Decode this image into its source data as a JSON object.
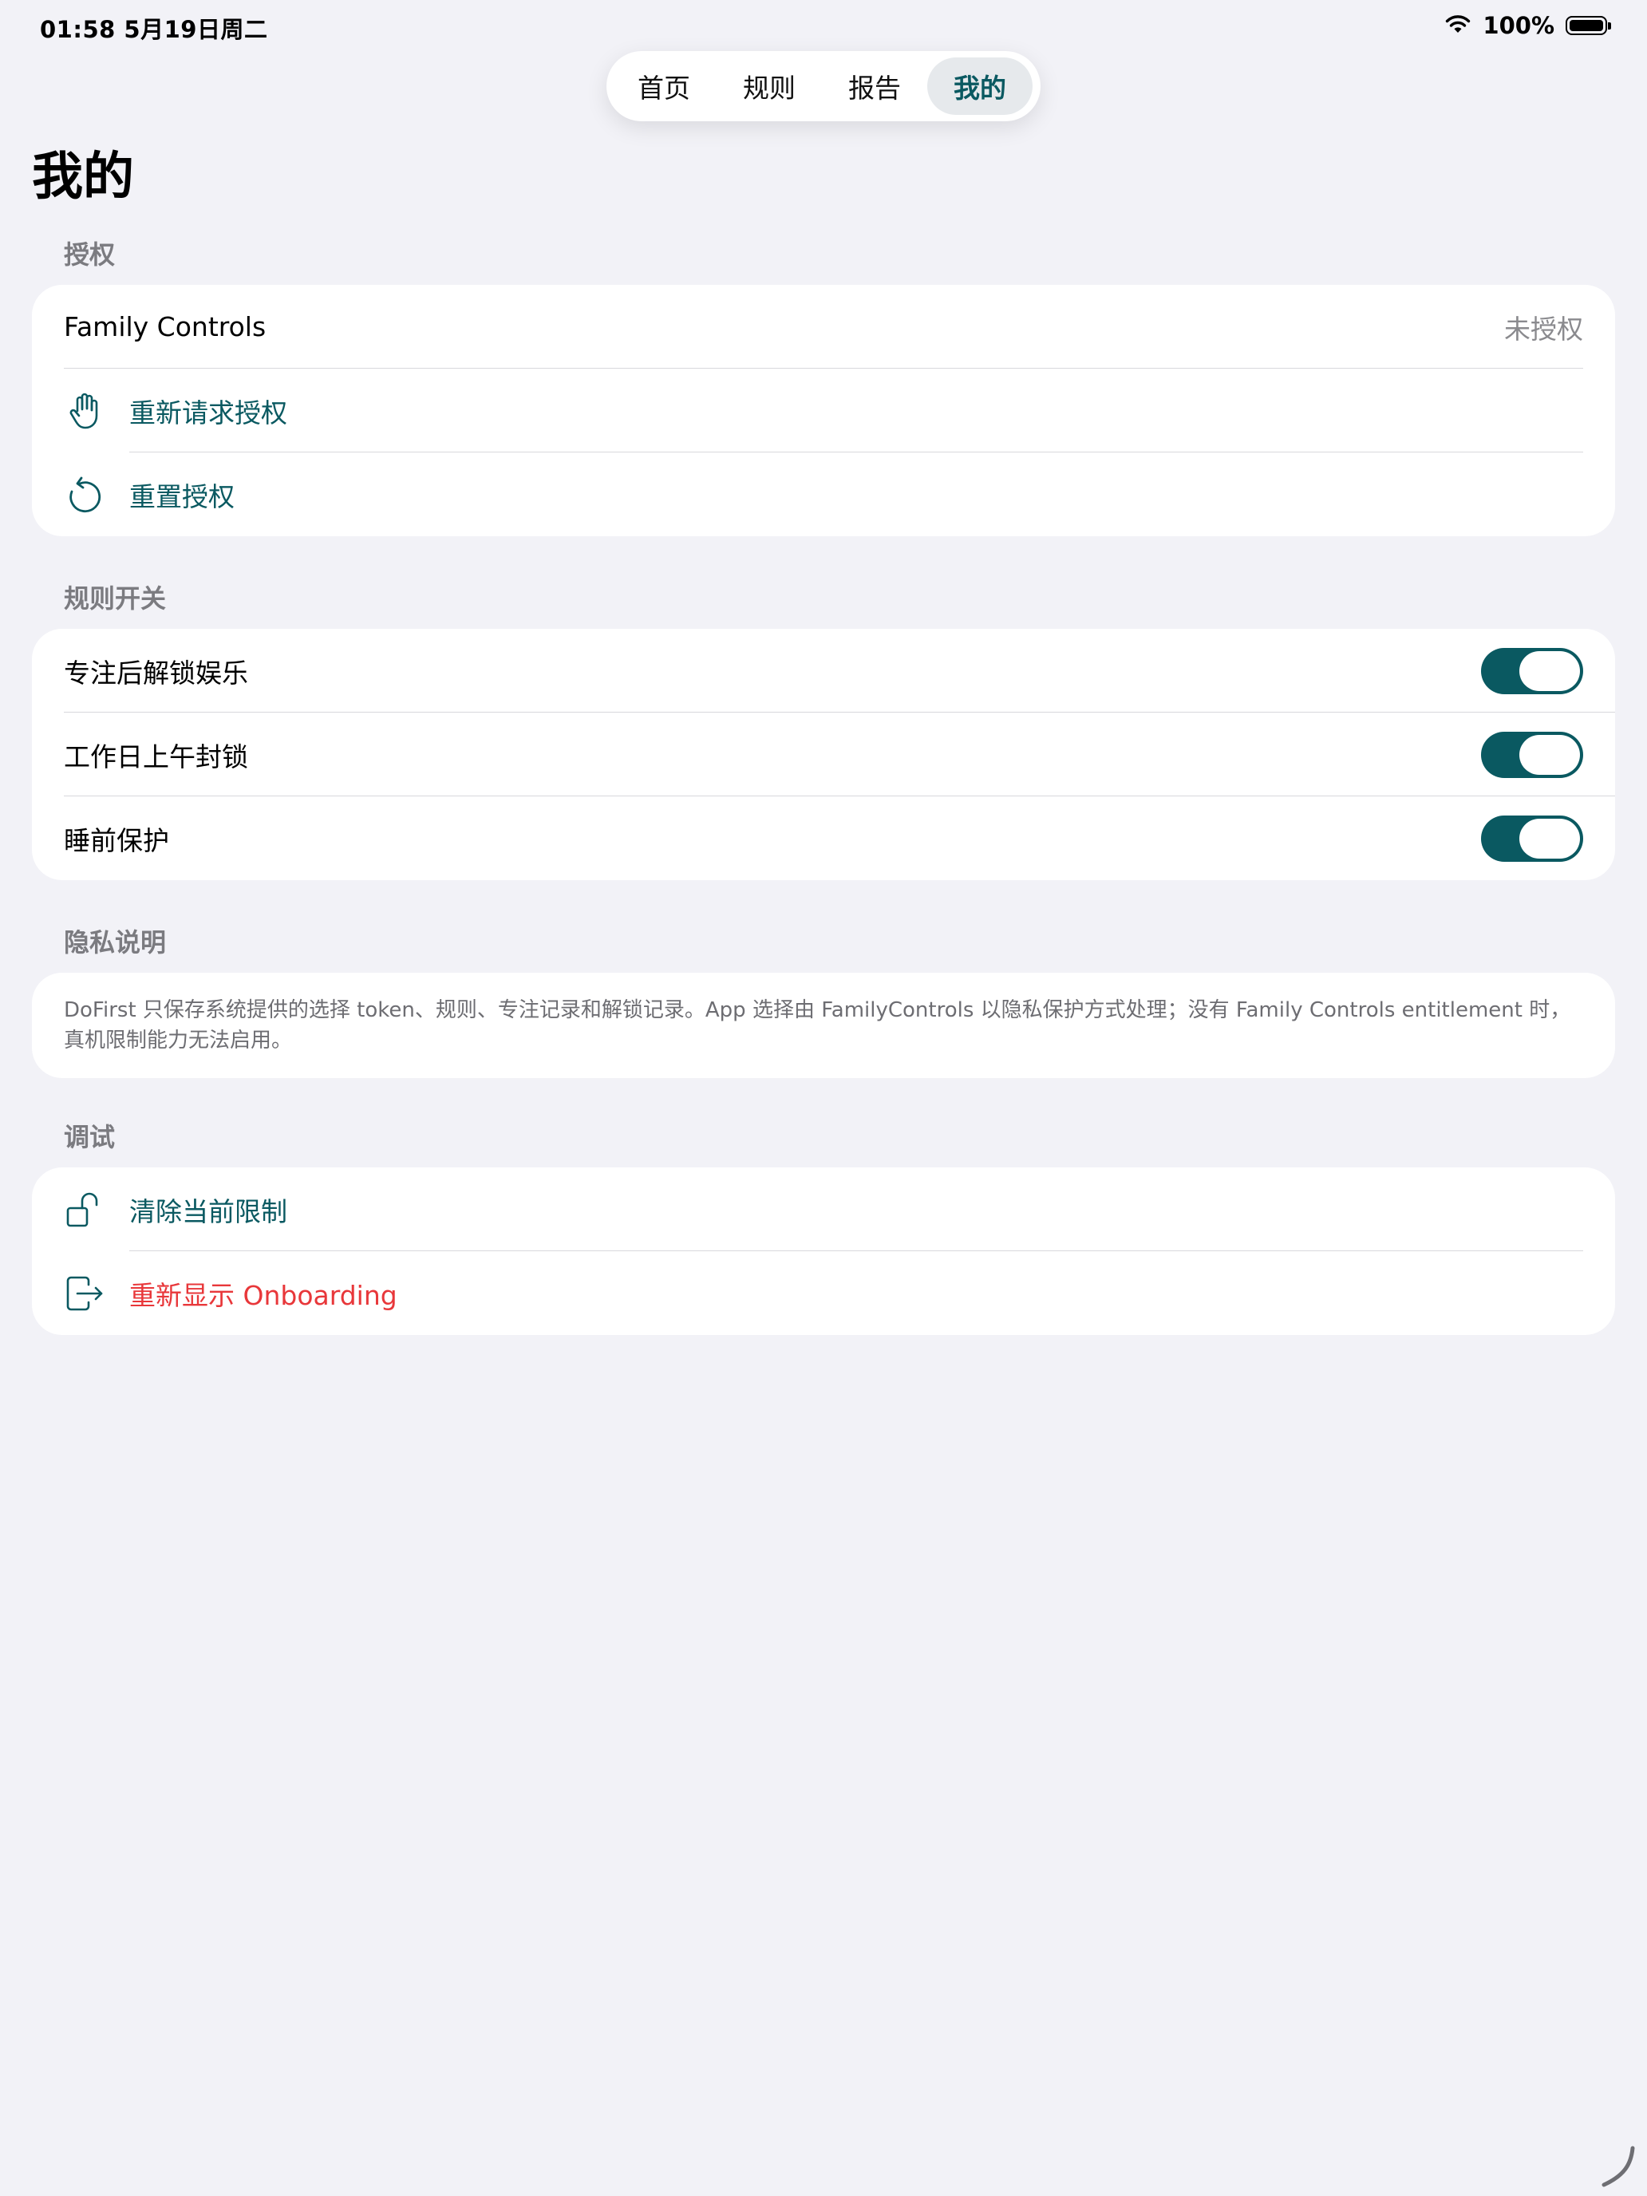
{
  "status_bar": {
    "time_date": "01:58   5月19日周二",
    "battery_percent": "100%",
    "battery_level": 1.0
  },
  "tabs": [
    {
      "label": "首页",
      "selected": false
    },
    {
      "label": "规则",
      "selected": false
    },
    {
      "label": "报告",
      "selected": false
    },
    {
      "label": "我的",
      "selected": true
    }
  ],
  "page_title": "我的",
  "authorization": {
    "header": "授权",
    "family_controls_label": "Family Controls",
    "family_controls_status": "未授权",
    "request_label": "重新请求授权",
    "request_icon": "hand-raised-icon",
    "reset_label": "重置授权",
    "reset_icon": "arrow-counterclockwise-icon"
  },
  "rules": {
    "header": "规则开关",
    "items": [
      {
        "label": "专注后解锁娱乐",
        "enabled": true
      },
      {
        "label": "工作日上午封锁",
        "enabled": true
      },
      {
        "label": "睡前保护",
        "enabled": true
      }
    ]
  },
  "privacy": {
    "header": "隐私说明",
    "text": "DoFirst 只保存系统提供的选择 token、规则、专注记录和解锁记录。App 选择由 FamilyControls 以隐私保护方式处理；没有 Family Controls entitlement 时，真机限制能力无法启用。"
  },
  "debug": {
    "header": "调试",
    "clear_label": "清除当前限制",
    "clear_icon": "lock-open-icon",
    "onboarding_label": "重新显示 Onboarding",
    "onboarding_icon": "exit-arrow-icon"
  },
  "colors": {
    "accent": "#0a5961",
    "destructive": "#e8373a",
    "background": "#f2f2f7",
    "secondary_text": "#8a8a8e"
  }
}
